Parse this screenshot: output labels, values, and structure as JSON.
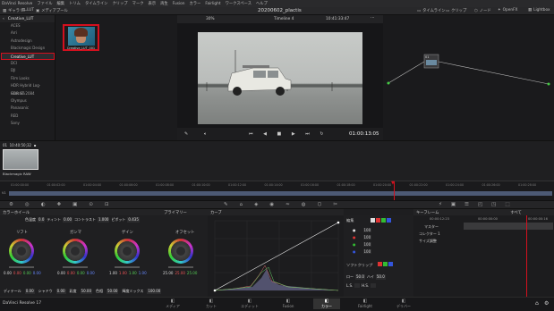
{
  "menu": [
    "DaVinci Resolve",
    "ファイル",
    "編集",
    "トリム",
    "タイムライン",
    "クリップ",
    "マーク",
    "表示",
    "再生",
    "Fusion",
    "カラー",
    "Fairlight",
    "ワークスペース",
    "ヘルプ"
  ],
  "toolbar": {
    "gallery": "ギャラリー",
    "lut": "LUT",
    "media_pool": "メディアプール",
    "title": "20200602_plactis",
    "timeline_label": "タイムライン",
    "clip_label": "クリップ",
    "node_label": "ノード",
    "openfx": "OpenFX",
    "lightbox": "Lightbox",
    "zoom": "30%",
    "timeline_name": "Timeline 4",
    "timecode_top": "10:41:33:47",
    "clip_menu": "クリップ"
  },
  "library": {
    "header": "Creative_LUT",
    "items": [
      "ACES",
      "Arri",
      "Astrodesign",
      "Blackmagic Design",
      "Creative_LUT",
      "DCI",
      "DJI",
      "Film Looks",
      "HDR Hybrid Log-Gamma",
      "HDR ST 2084",
      "Olympus",
      "Panasonic",
      "RED",
      "Sony"
    ],
    "selected": "Creative_LUT"
  },
  "browser": {
    "thumb_label": "Creative_LUT_001"
  },
  "viewer": {
    "timecode": "01:00:13:05"
  },
  "timeline_clip": {
    "index": "01",
    "timecode": "10:40:50;32",
    "name": "Blackmagic RAW",
    "track": "V1"
  },
  "ruler_ticks": [
    "01:00:00:00",
    "01:00:02:00",
    "01:00:04:00",
    "01:00:06:00",
    "01:00:08:00",
    "01:00:10:00",
    "01:00:12:00",
    "01:00:14:00",
    "01:00:16:00",
    "01:00:18:00",
    "01:00:20:00",
    "01:00:22:00",
    "01:00:24:00",
    "01:00:26:00",
    "01:00:28:00"
  ],
  "wheels": {
    "header": "カラーホイール",
    "mode": "プライマリー",
    "contrast_label": "コントラスト",
    "contrast": "1.000",
    "pivot_label": "ピボット",
    "pivot": "0.435",
    "temp_label": "色温度",
    "temp": "0.0",
    "tint_label": "ティント",
    "tint": "0.00",
    "items": [
      {
        "name": "リフト",
        "vals": [
          "0.00",
          "0.00",
          "0.00",
          "0.00"
        ]
      },
      {
        "name": "ガンマ",
        "vals": [
          "0.00",
          "0.00",
          "0.00",
          "0.00"
        ]
      },
      {
        "name": "ゲイン",
        "vals": [
          "1.00",
          "1.00",
          "1.00",
          "1.00"
        ]
      },
      {
        "name": "オフセット",
        "vals": [
          "25.00",
          "25.00",
          "25.00"
        ]
      }
    ],
    "footer": {
      "contrast_detail_label": "ディテール",
      "contrast_detail": "0.00",
      "shadow_label": "シャドウ",
      "shadow": "0.00",
      "midtone_label": "ミッドトーン",
      "saturation_label": "彩度",
      "saturation": "50.00",
      "hue_label": "色相",
      "hue": "50.00",
      "lum_mix_label": "輝度ミックス",
      "lum_mix": "100.00"
    }
  },
  "curves": {
    "header": "カーブ",
    "edit_label": "編集",
    "soft_clip_label": "ソフトクリップ",
    "intensity": [
      "100",
      "100",
      "100",
      "100"
    ],
    "low": "50.0",
    "high": "50.0",
    "low_label": "ロー",
    "high_label": "ハイ",
    "ls_label": "L.S.",
    "hs_label": "H.S."
  },
  "keyframes": {
    "header": "キーフレーム",
    "filter": "すべて",
    "timecode1": "00:00:12:23",
    "timecode2": "00:00:00:00",
    "timecode3": "00:00:00:16",
    "rows": [
      "マスター",
      "コレクター 1",
      "サイズ調整"
    ]
  },
  "bottom": {
    "app": "DaVinci Resolve 17",
    "pages": [
      "メディア",
      "カット",
      "エディット",
      "Fusion",
      "カラー",
      "Fairlight",
      "デリバー"
    ],
    "active_page": "カラー"
  },
  "colors": {
    "accent": "#d4101e",
    "bg": "#1e1e20"
  }
}
